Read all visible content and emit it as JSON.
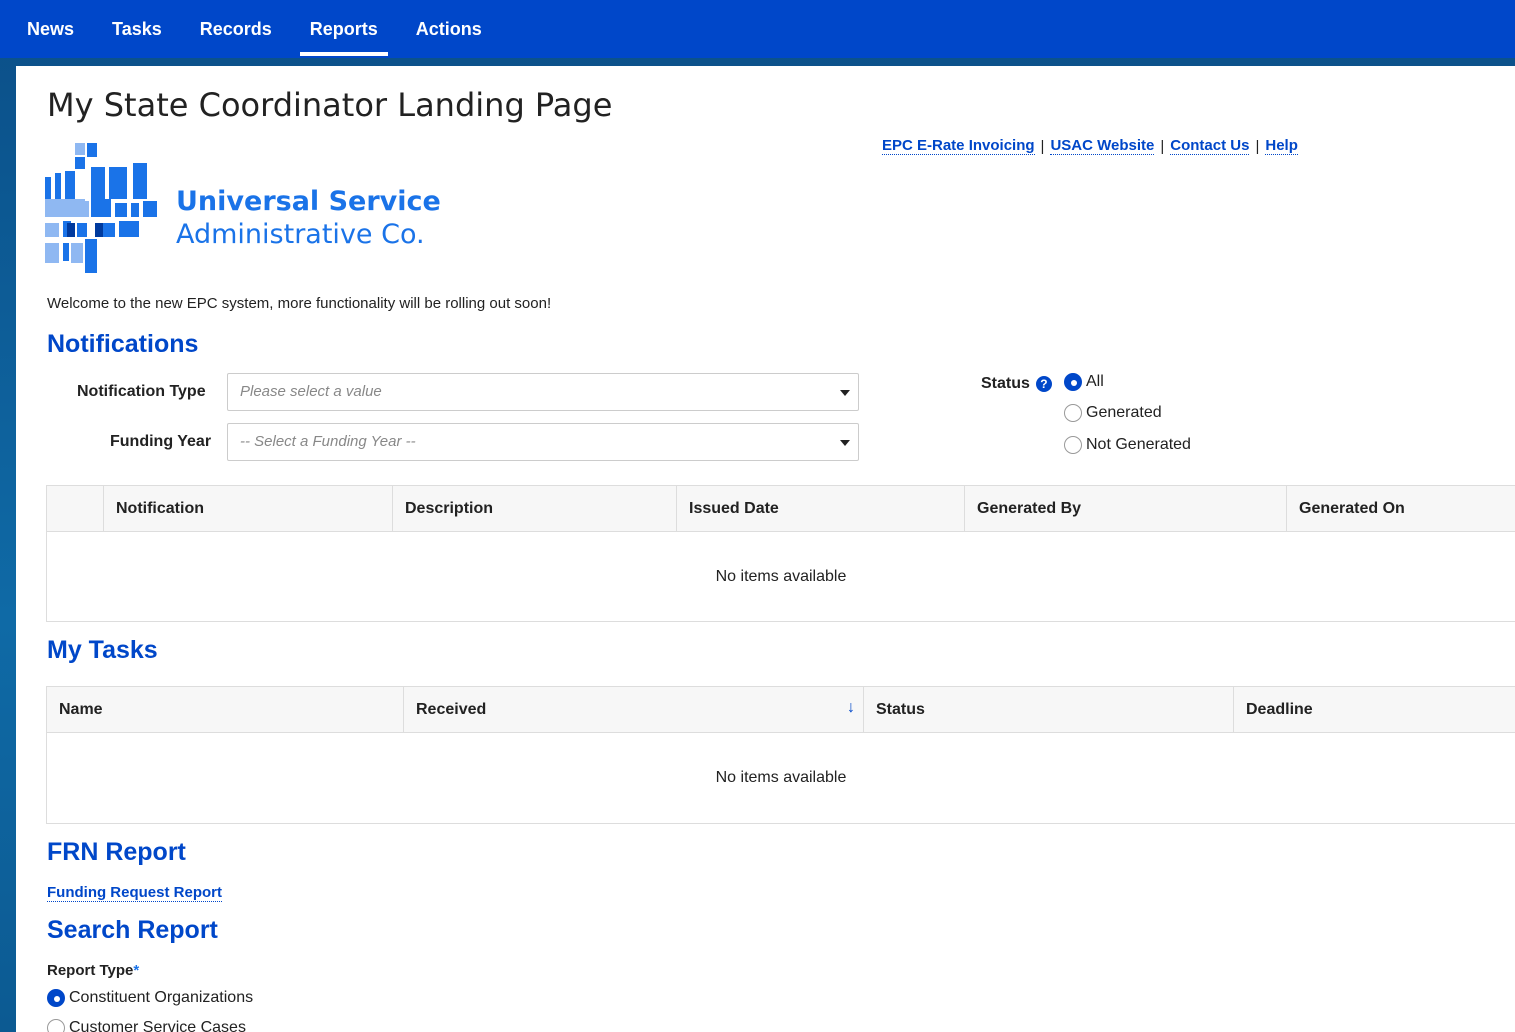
{
  "nav": {
    "items": [
      "News",
      "Tasks",
      "Records",
      "Reports",
      "Actions"
    ],
    "active": "Reports"
  },
  "page": {
    "title": "My State Coordinator Landing Page",
    "links": [
      "EPC E-Rate Invoicing",
      "USAC Website",
      "Contact Us",
      "Help"
    ],
    "logo": {
      "line1": "Universal Service",
      "line2": "Administrative Co."
    },
    "welcome": "Welcome to the new EPC system, more functionality will be rolling out soon!"
  },
  "notifications": {
    "title": "Notifications",
    "notification_type_label": "Notification Type",
    "notification_type_placeholder": "Please select a value",
    "funding_year_label": "Funding Year",
    "funding_year_placeholder": "-- Select a Funding Year --",
    "status_label": "Status",
    "status_options": [
      "All",
      "Generated",
      "Not Generated"
    ],
    "status_selected": "All",
    "columns": [
      "Notification",
      "Description",
      "Issued Date",
      "Generated By",
      "Generated On"
    ],
    "empty": "No items available"
  },
  "tasks": {
    "title": "My Tasks",
    "columns": [
      "Name",
      "Received",
      "Status",
      "Deadline"
    ],
    "empty": "No items available"
  },
  "frn": {
    "title": "FRN Report",
    "link": "Funding Request Report"
  },
  "search": {
    "title": "Search Report",
    "report_type_label": "Report Type",
    "required_mark": "*",
    "options": [
      "Constituent Organizations",
      "Customer Service Cases"
    ],
    "selected": "Constituent Organizations"
  },
  "colors": {
    "brand": "#0047c9",
    "logo_blue": "#1a73e8"
  }
}
